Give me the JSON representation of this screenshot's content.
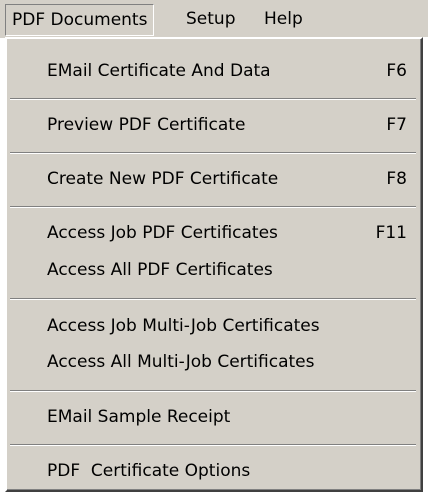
{
  "menubar": {
    "items": [
      {
        "label": "PDF Documents"
      },
      {
        "label": "Setup"
      },
      {
        "label": "Help"
      }
    ]
  },
  "menu": {
    "items": [
      {
        "label": "EMail Certificate And Data",
        "shortcut": "F6"
      },
      {
        "label": "Preview PDF Certificate",
        "shortcut": "F7"
      },
      {
        "label": "Create New PDF Certificate",
        "shortcut": "F8"
      },
      {
        "label": "Access Job PDF Certificates",
        "shortcut": "F11"
      },
      {
        "label": "Access All PDF Certificates",
        "shortcut": ""
      },
      {
        "label": "Access Job Multi-Job Certificates",
        "shortcut": ""
      },
      {
        "label": "Access All Multi-Job Certificates",
        "shortcut": ""
      },
      {
        "label": "EMail Sample Receipt",
        "shortcut": ""
      },
      {
        "label": "PDF  Certificate Options",
        "shortcut": ""
      }
    ]
  }
}
